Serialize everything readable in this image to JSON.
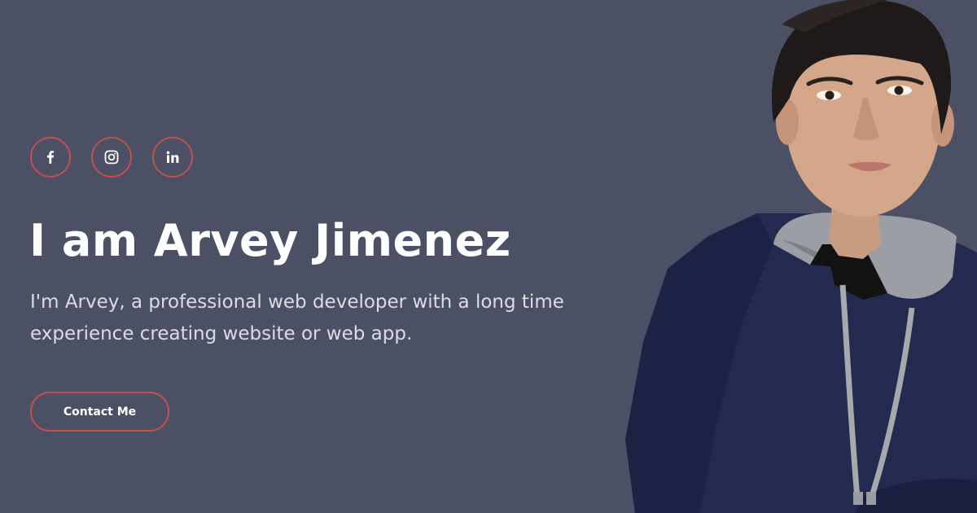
{
  "social": [
    {
      "name": "facebook",
      "icon": "facebook-icon"
    },
    {
      "name": "instagram",
      "icon": "instagram-icon"
    },
    {
      "name": "linkedin",
      "icon": "linkedin-icon"
    }
  ],
  "hero": {
    "headline": "I am Arvey Jimenez",
    "bio": "I'm Arvey, a professional web developer with a long time experience creating website or web app.",
    "cta_label": "Contact Me"
  },
  "colors": {
    "background": "#4b5065",
    "accent": "#c0504d",
    "text": "#ffffff",
    "muted_text": "#dcdde3"
  }
}
